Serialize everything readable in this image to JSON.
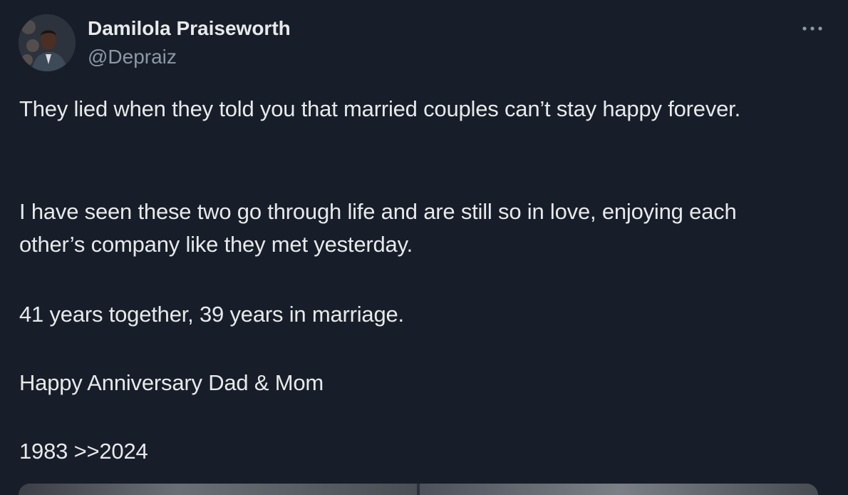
{
  "author": {
    "name": "Damilola Praiseworth",
    "handle": "@Depraiz",
    "avatar_icon": "profile-photo"
  },
  "menu": {
    "icon": "more-options-icon"
  },
  "tweet": {
    "paragraphs": [
      "They lied when they told you that married couples can’t stay happy forever.",
      "I have seen these two go through life and are still so in love, enjoying each other’s company like they met yesterday.",
      "41 years together, 39 years in marriage.",
      "Happy Anniversary Dad & Mom",
      "1983 >>2024"
    ]
  },
  "colors": {
    "background": "#171e29",
    "text": "#e7e9ea",
    "secondary_text": "#8b98a5"
  }
}
